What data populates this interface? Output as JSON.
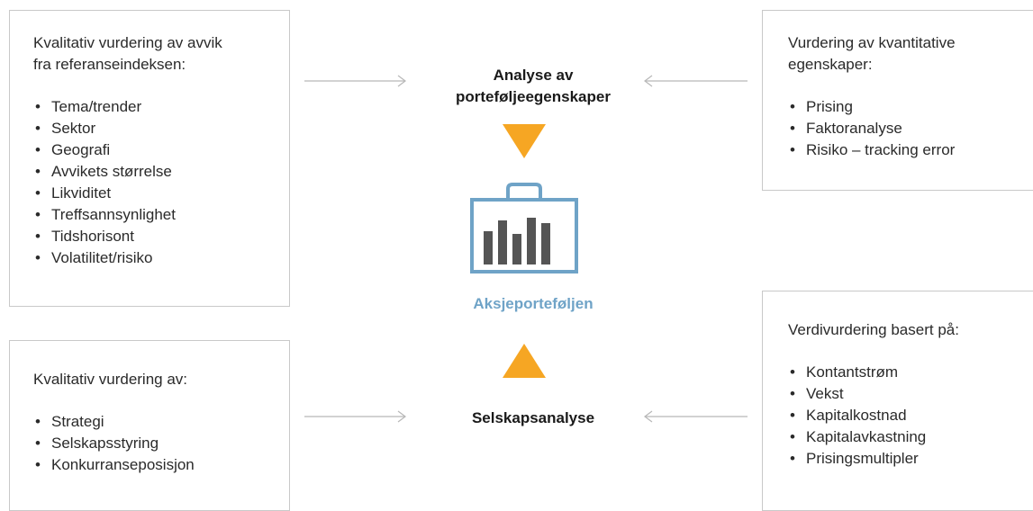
{
  "colors": {
    "accent_orange": "#f6a623",
    "portfolio_blue": "#6fa3c7",
    "bar_gray": "#555555",
    "box_border": "#c9c9c9",
    "arrow_gray": "#b8b8b8"
  },
  "top_left": {
    "heading": "Kvalitativ vurdering av avvik\nfra referanseindeksen:",
    "items": [
      "Tema/trender",
      "Sektor",
      "Geografi",
      "Avvikets størrelse",
      "Likviditet",
      "Treffsannsynlighet",
      "Tidshorisont",
      "Volatilitet/risiko"
    ]
  },
  "bottom_left": {
    "heading": "Kvalitativ vurdering av:",
    "items": [
      "Strategi",
      "Selskapsstyring",
      "Konkurranseposisjon"
    ]
  },
  "top_right": {
    "heading": "Vurdering av kvantitative\negenskaper:",
    "items": [
      "Prising",
      "Faktoranalyse",
      "Risiko – tracking error"
    ]
  },
  "bottom_right": {
    "heading": "Verdivurdering basert på:",
    "items": [
      "Kontantstrøm",
      "Vekst",
      "Kapitalkostnad",
      "Kapitalavkastning",
      "Prisingsmultipler"
    ]
  },
  "center": {
    "top_label": "Analyse av\nporteføljeegenskaper",
    "portfolio_label": "Aksjeporteføljen",
    "bottom_label": "Selskapsanalyse",
    "icon": "briefcase-bar-chart-icon"
  }
}
